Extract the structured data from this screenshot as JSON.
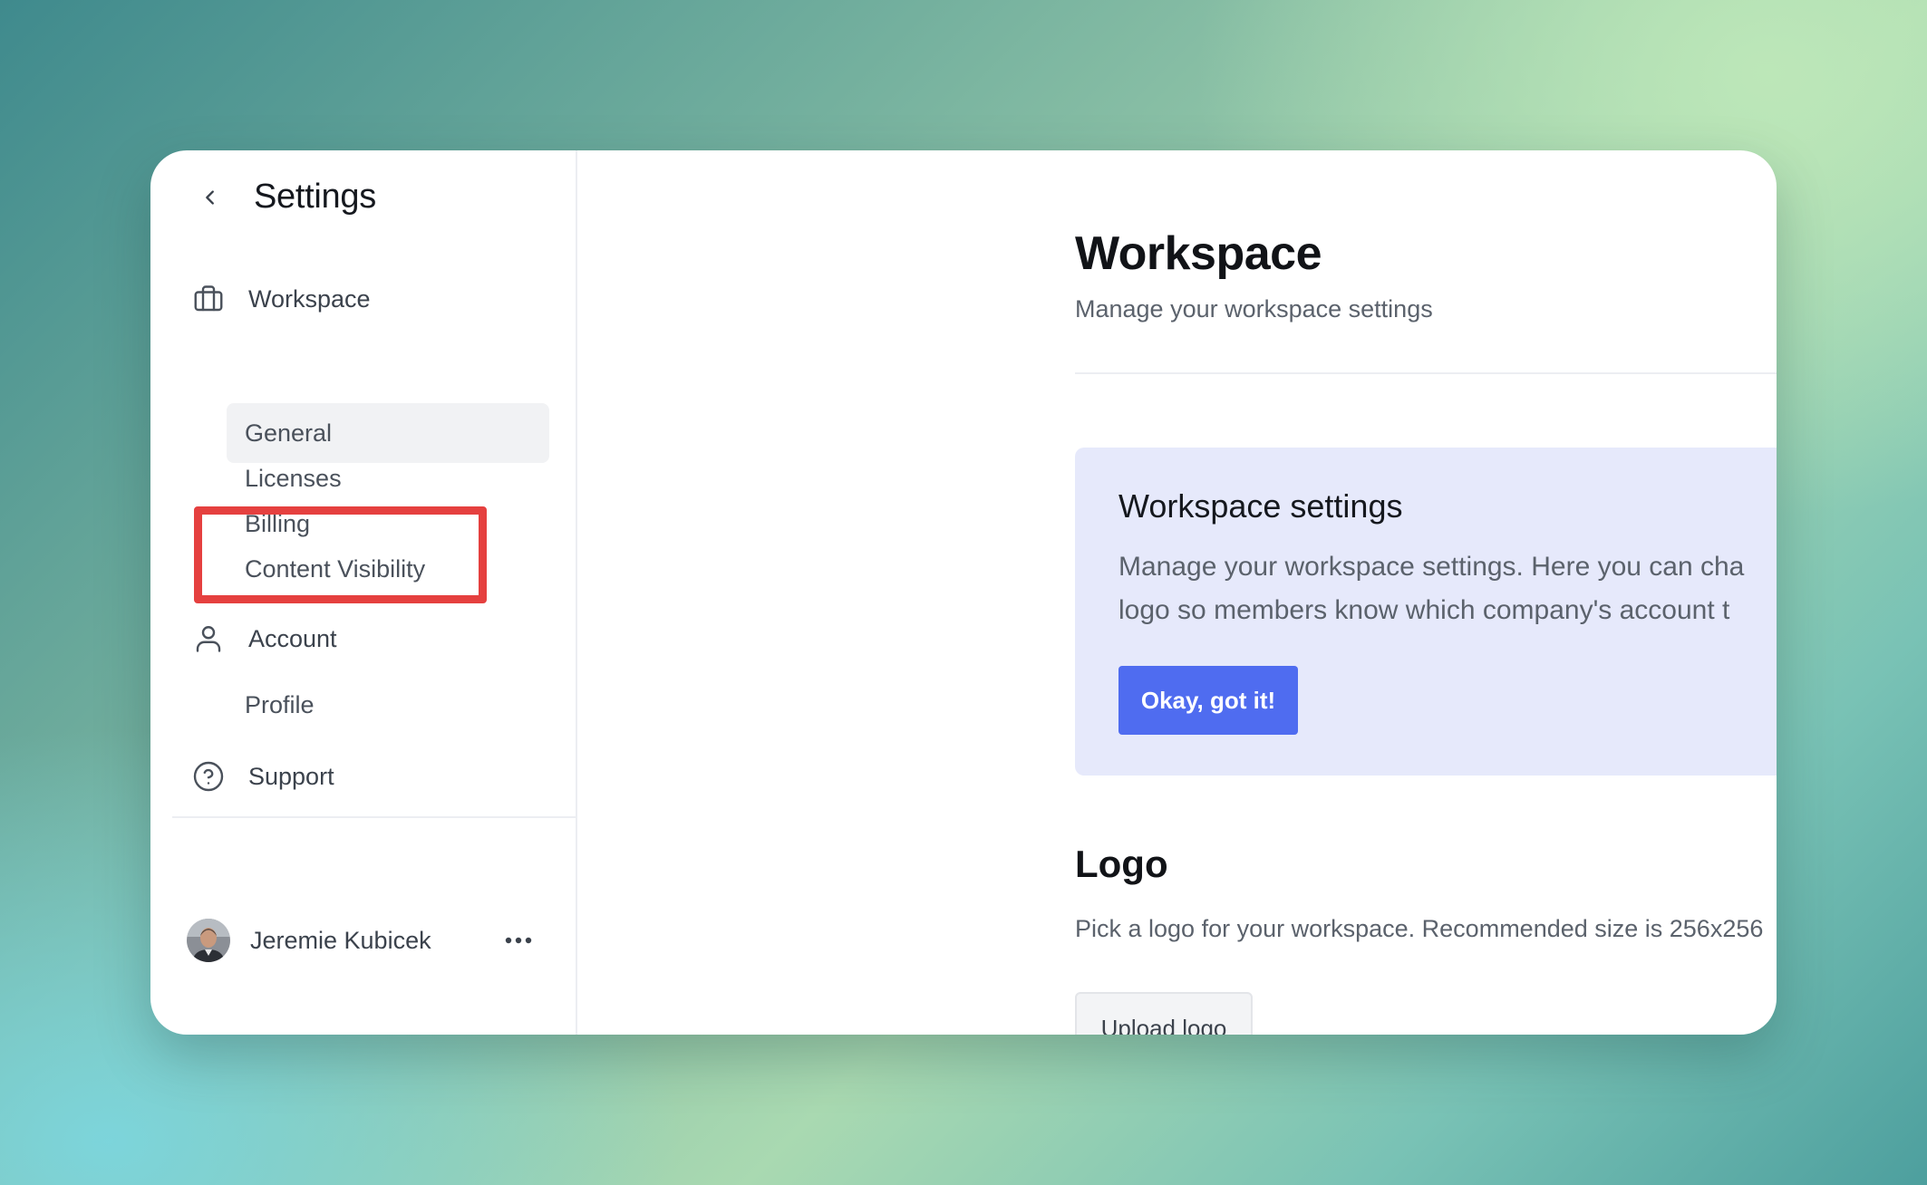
{
  "sidebar": {
    "title": "Settings",
    "back_icon": "chevron-left-icon",
    "sections": [
      {
        "label": "Workspace",
        "icon": "briefcase-icon",
        "items": [
          {
            "label": "General",
            "active": true
          },
          {
            "label": "Licenses",
            "active": false
          },
          {
            "label": "Billing",
            "active": false
          },
          {
            "label": "Content Visibility",
            "active": false,
            "highlighted": true
          }
        ]
      },
      {
        "label": "Account",
        "icon": "user-icon",
        "items": [
          {
            "label": "Profile",
            "active": false
          }
        ]
      }
    ],
    "support": {
      "label": "Support",
      "icon": "help-circle-icon"
    },
    "user": {
      "name": "Jeremie Kubicek",
      "more_icon": "more-horizontal-icon"
    }
  },
  "main": {
    "title": "Workspace",
    "subtitle": "Manage your workspace settings",
    "info_card": {
      "title": "Workspace settings",
      "text_line1": "Manage your workspace settings. Here you can cha",
      "text_line2": "logo so members know which company's account t",
      "button_label": "Okay, got it!"
    },
    "logo_section": {
      "title": "Logo",
      "description": "Pick a logo for your workspace. Recommended size is 256x256",
      "upload_label": "Upload logo"
    }
  },
  "colors": {
    "highlight": "#e5403f",
    "accent": "#4f6cf0",
    "info_card_bg": "#e6e9fb",
    "active_item_bg": "#f1f2f4"
  }
}
